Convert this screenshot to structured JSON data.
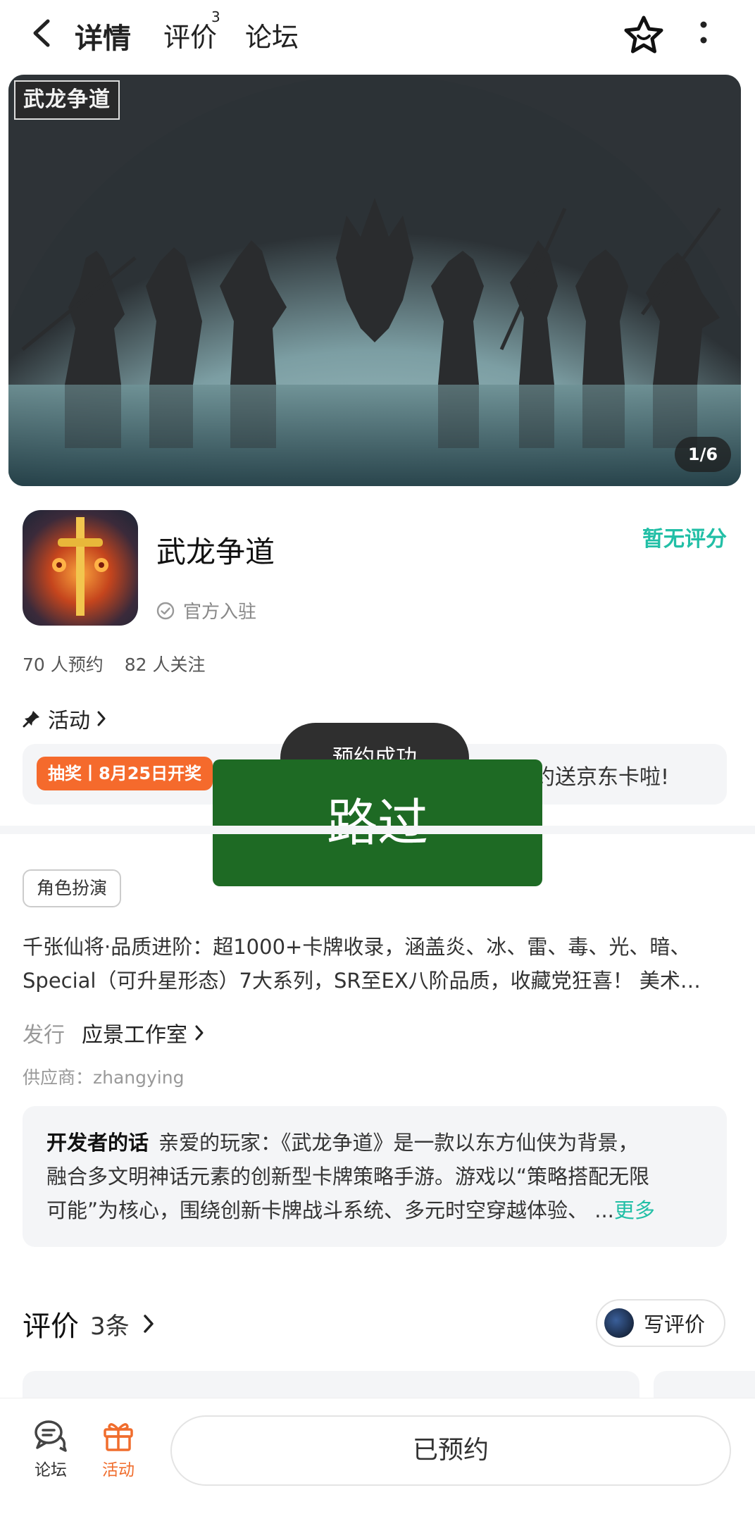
{
  "header": {
    "tabs": [
      {
        "label": "详情"
      },
      {
        "label": "评价",
        "badge": "3"
      },
      {
        "label": "论坛"
      }
    ]
  },
  "banner": {
    "logo_text": "武龙争道",
    "counter": "1/6"
  },
  "game": {
    "name": "武龙争道",
    "official_label": "官方入驻",
    "rating_text": "暂无评分",
    "reservations": "70 人预约",
    "followers": "82 人关注"
  },
  "activity": {
    "title": "活动",
    "badge": "抽奖丨8月25日开奖",
    "text": "约送京东卡啦!"
  },
  "overlay": {
    "toast": "预约成功",
    "pass_button": "路过"
  },
  "details": {
    "genre_tag": "角色扮演",
    "description_lines": [
      "千张仙将·品质进阶：超1000+卡牌收录，涵盖炎、冰、雷、毒、光、暗、",
      "Special（可升星形态）7大系列，SR至EX八阶品质，收藏党狂喜！ 美术…"
    ],
    "publisher_label": "发行",
    "publisher_name": "应景工作室",
    "supplier": "供应商：zhangying"
  },
  "developer": {
    "label": "开发者的话",
    "line1": "亲爱的玩家：《武龙争道》是一款以东方仙侠为背景，",
    "line2": "融合多文明神话元素的创新型卡牌策略手游。游戏以“策略搭配无限",
    "line3": "可能”为核心，围绕创新卡牌战斗系统、多元时空穿越体验、 ...",
    "more": "更多"
  },
  "reviews": {
    "title": "评价",
    "count": "3条",
    "write_label": "写评价"
  },
  "bottom_bar": {
    "forum_label": "论坛",
    "activity_label": "活动",
    "reserved_label": "已预约"
  },
  "colors": {
    "accent": "#22bfa6",
    "orange": "#f56a2c",
    "pass_green": "#1e6a24"
  }
}
